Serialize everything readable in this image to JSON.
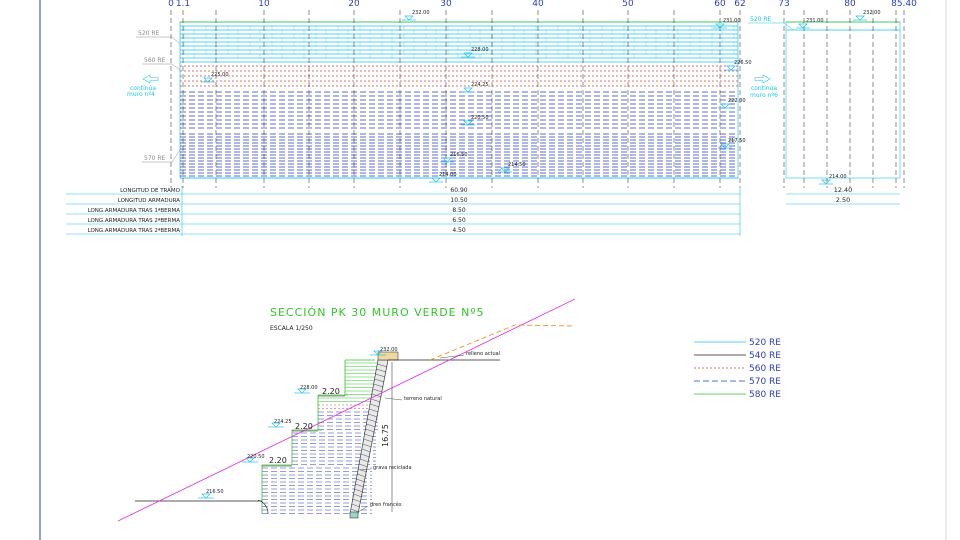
{
  "colors": {
    "cyan": "#22c4e8",
    "blue": "#2b3fb8",
    "red": "#d0453a",
    "green": "#33c52b",
    "magenta": "#e23be0",
    "orange": "#e8952a",
    "black": "#222222",
    "grey": "#8a8a8a"
  },
  "elevation": {
    "stations": [
      "0",
      "1.1",
      "10",
      "20",
      "30",
      "40",
      "50",
      "60",
      "62",
      "73",
      "80",
      "85.40"
    ],
    "layer_labels": {
      "l520": "520 RE",
      "l560": "560 RE",
      "l570": "570 RE",
      "l520_right": "520 RE"
    },
    "continua_left": {
      "line1": "continúa",
      "line2": "muro nº4"
    },
    "continua_right": {
      "line1": "continúa",
      "line2": "muro nº6"
    },
    "levels": {
      "l232": "232.00",
      "l231a": "231.00",
      "l228": "228.00",
      "l226_5": "226.50",
      "l225": "225.00",
      "l224_25": "224.25",
      "l222": "222.00",
      "l220_5": "220.50",
      "l217_5": "217.50",
      "l216_5": "216.50",
      "l214_5": "214.50",
      "l214": "214.00",
      "r231": "231.00",
      "r232": "232.00",
      "r214": "214.00"
    },
    "table": {
      "rows": [
        {
          "label": "LONGITUD DE TRAMO",
          "value": "60.90",
          "right": "12.40"
        },
        {
          "label": "LONGITUD ARMADURA",
          "value": "10.50",
          "right": "2.50"
        },
        {
          "label": "LONG.ARMADURA TRAS 1ªBERMA",
          "value": "8.50",
          "right": ""
        },
        {
          "label": "LONG.ARMADURA TRAS 2ªBERMA",
          "value": "6.50",
          "right": ""
        },
        {
          "label": "LONG.ARMADURA TRAS 2ªBERMA",
          "value": "4.50",
          "right": ""
        }
      ]
    }
  },
  "section": {
    "title": "SECCIÓN PK 30 MURO VERDE Nº5",
    "scale": "ESCALA 1/250",
    "level_232": "232.00",
    "level_228": "228.00",
    "level_224_25": "224.25",
    "level_220_5": "220.50",
    "level_216_5": "216.50",
    "berm1": "2.20",
    "berm2": "2.20",
    "berm3": "2.20",
    "height": "16.75",
    "relleno_actual": "relleno actual",
    "terreno_natural": "terreno natural",
    "grava_reciclada": "grava reciclada",
    "dren_frances": "dren francés"
  },
  "legend": [
    {
      "label": "520 RE",
      "color": "#22c4e8",
      "dash": ""
    },
    {
      "label": "540 RE",
      "color": "#222222",
      "dash": ""
    },
    {
      "label": "560 RE",
      "color": "#d0453a",
      "dash": "2 2"
    },
    {
      "label": "570 RE",
      "color": "#2b3fb8",
      "dash": "6 3"
    },
    {
      "label": "580 RE",
      "color": "#33c52b",
      "dash": ""
    }
  ]
}
